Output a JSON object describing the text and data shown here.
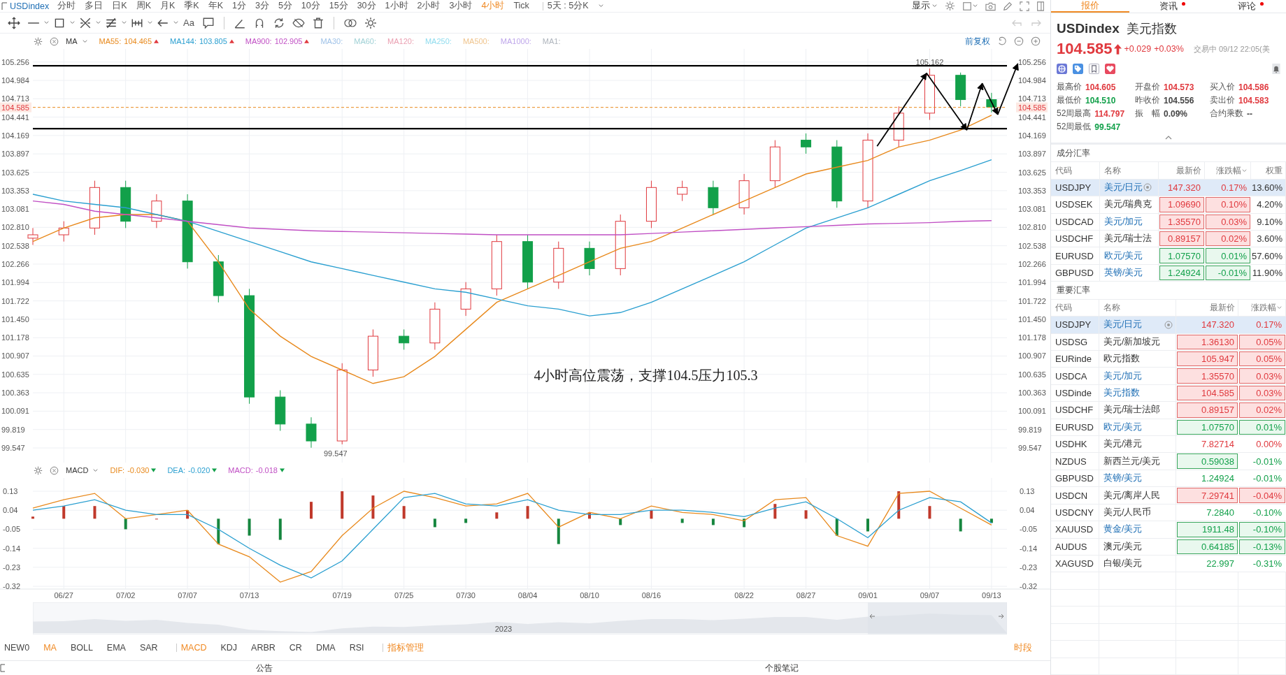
{
  "top_bar": {
    "symbol": "USDindex",
    "periods": [
      {
        "label": "分时",
        "selected": false
      },
      {
        "label": "多日",
        "selected": false
      },
      {
        "label": "日K",
        "selected": false
      },
      {
        "label": "周K",
        "selected": false
      },
      {
        "label": "月K",
        "selected": false
      },
      {
        "label": "季K",
        "selected": false
      },
      {
        "label": "年K",
        "selected": false
      },
      {
        "label": "1分",
        "selected": false
      },
      {
        "label": "3分",
        "selected": false
      },
      {
        "label": "5分",
        "selected": false
      },
      {
        "label": "10分",
        "selected": false
      },
      {
        "label": "15分",
        "selected": false
      },
      {
        "label": "30分",
        "selected": false
      },
      {
        "label": "1小时",
        "selected": false
      },
      {
        "label": "2小时",
        "selected": false
      },
      {
        "label": "3小时",
        "selected": false
      },
      {
        "label": "4小时",
        "selected": true
      },
      {
        "label": "Tick",
        "selected": false
      }
    ],
    "range_select": "5天 : 5分K",
    "display_menu": "显示"
  },
  "toolbar": {
    "text_tool": "Aa"
  },
  "indicator_legend": {
    "name": "MA",
    "adjust_label": "前复权",
    "items": [
      {
        "label": "MA55:",
        "value": "104.465",
        "color": "#e8891c",
        "rising": true
      },
      {
        "label": "MA144:",
        "value": "103.805",
        "color": "#2a9fd0",
        "rising": true
      },
      {
        "label": "MA900:",
        "value": "102.905",
        "color": "#c04fc4",
        "rising": true
      },
      {
        "label": "MA30:",
        "color": "#9fc2e8"
      },
      {
        "label": "MA60:",
        "color": "#9fd0d5"
      },
      {
        "label": "MA120:",
        "color": "#ea9fb1"
      },
      {
        "label": "MA250:",
        "color": "#8fdcee"
      },
      {
        "label": "MA500:",
        "color": "#efc48d"
      },
      {
        "label": "MA1000:",
        "color": "#bea6ea"
      },
      {
        "label": "MA1:",
        "color": "#aeb4bc"
      }
    ]
  },
  "chart": {
    "right_axis": [
      "105.256",
      "104.984",
      "104.713",
      "104.441",
      "104.169",
      "103.897",
      "103.625",
      "103.353",
      "103.081",
      "102.810",
      "102.538",
      "102.266",
      "101.994",
      "101.722",
      "101.450",
      "101.178",
      "100.907",
      "100.635",
      "100.363",
      "100.091",
      "99.819",
      "99.547"
    ],
    "right_price_tag": "104.585",
    "chart_data": {
      "type": "candlestick",
      "grid": true,
      "ylim": [
        99.33,
        105.45
      ],
      "categories": [
        null,
        null,
        null,
        null,
        null,
        null,
        null,
        null,
        null,
        null,
        null,
        null,
        null,
        null,
        null,
        null,
        null,
        null,
        null,
        null,
        null,
        null,
        null,
        null,
        null,
        null,
        null,
        null,
        null,
        null,
        null,
        null
      ],
      "yticks": [
        105.256,
        104.984,
        104.713,
        104.441,
        104.169,
        103.897,
        103.625,
        103.353,
        103.081,
        {
          "value": 102.81,
          "label": "102.810"
        },
        102.538,
        102.266,
        101.994,
        101.722,
        {
          "value": 101.45,
          "label": "101.450"
        },
        101.178,
        100.907,
        100.635,
        100.363,
        100.091,
        99.819,
        99.547
      ],
      "ohlc": [
        [
          102.65,
          102.8,
          102.55,
          102.7
        ],
        [
          102.7,
          102.9,
          102.6,
          102.8
        ],
        [
          102.8,
          103.5,
          102.7,
          103.4
        ],
        [
          103.4,
          103.5,
          102.8,
          102.9
        ],
        [
          102.9,
          103.3,
          102.8,
          103.2
        ],
        [
          103.2,
          103.3,
          102.2,
          102.3
        ],
        [
          102.3,
          102.4,
          101.7,
          101.8
        ],
        [
          101.8,
          101.9,
          100.2,
          100.3
        ],
        [
          100.3,
          100.4,
          99.8,
          99.9
        ],
        [
          99.9,
          100.0,
          99.55,
          99.65
        ],
        [
          99.65,
          100.8,
          99.6,
          100.7
        ],
        [
          100.7,
          101.3,
          100.6,
          101.2
        ],
        [
          101.2,
          101.3,
          101.0,
          101.1
        ],
        [
          101.1,
          101.7,
          101.0,
          101.6
        ],
        [
          101.6,
          102.0,
          101.5,
          101.9
        ],
        [
          101.9,
          102.7,
          101.8,
          102.6
        ],
        [
          102.6,
          102.7,
          101.9,
          102.0
        ],
        [
          102.0,
          102.6,
          101.9,
          102.5
        ],
        [
          102.5,
          102.6,
          102.1,
          102.2
        ],
        [
          102.2,
          103.0,
          102.1,
          102.9
        ],
        [
          102.9,
          103.5,
          102.8,
          103.4
        ],
        [
          103.3,
          103.5,
          103.2,
          103.4
        ],
        [
          103.4,
          103.5,
          103.0,
          103.1
        ],
        [
          103.1,
          103.6,
          103.0,
          103.5
        ],
        [
          103.5,
          104.1,
          103.4,
          104.0
        ],
        [
          104.1,
          104.2,
          103.9,
          104.0
        ],
        [
          104.0,
          104.1,
          103.1,
          103.2
        ],
        [
          103.2,
          104.2,
          103.1,
          104.1
        ],
        [
          104.1,
          104.6,
          104.0,
          104.5
        ],
        [
          104.5,
          105.16,
          104.4,
          105.06
        ],
        [
          105.06,
          105.1,
          104.6,
          104.7
        ],
        [
          104.7,
          104.8,
          104.51,
          104.59
        ]
      ],
      "series": [
        {
          "type": "line",
          "color": "#e8891c",
          "values": [
            102.6,
            102.8,
            102.95,
            103.0,
            103.0,
            102.9,
            102.3,
            101.6,
            101.2,
            100.9,
            100.7,
            100.5,
            100.6,
            100.9,
            101.3,
            101.7,
            101.9,
            102.1,
            102.3,
            102.5,
            102.6,
            102.8,
            103.0,
            103.2,
            103.4,
            103.6,
            103.7,
            103.8,
            104.0,
            104.1,
            104.25,
            104.47
          ]
        },
        {
          "type": "line",
          "color": "#2a9fd0",
          "values": [
            103.3,
            103.2,
            103.15,
            103.1,
            103.0,
            102.9,
            102.75,
            102.6,
            102.45,
            102.3,
            102.2,
            102.1,
            102.0,
            101.9,
            101.85,
            101.75,
            101.65,
            101.6,
            101.5,
            101.55,
            101.7,
            101.9,
            102.1,
            102.3,
            102.55,
            102.8,
            102.95,
            103.1,
            103.3,
            103.5,
            103.65,
            103.81
          ]
        },
        {
          "type": "line",
          "color": "#c04fc4",
          "values": [
            103.2,
            103.15,
            103.05,
            103.0,
            102.95,
            102.9,
            102.85,
            102.8,
            102.78,
            102.76,
            102.75,
            102.74,
            102.73,
            102.72,
            102.71,
            102.7,
            102.7,
            102.7,
            102.7,
            102.7,
            102.72,
            102.74,
            102.76,
            102.78,
            102.8,
            102.82,
            102.84,
            102.86,
            102.87,
            102.88,
            102.9,
            102.91
          ]
        }
      ],
      "ref_lines": [
        {
          "axis": "y",
          "value": 105.2
        },
        {
          "axis": "y",
          "value": 104.27
        },
        {
          "axis": "y",
          "value": 104.585,
          "label": "104.585"
        }
      ],
      "annotations": [
        "105.162",
        "99.547",
        "4小时高位震荡，支撑104.5压力105.3"
      ]
    }
  },
  "macd_legend": {
    "name": "MACD",
    "items": [
      {
        "label": "DIF:",
        "value": "-0.030",
        "color": "#e8891c",
        "rising": false
      },
      {
        "label": "DEA:",
        "value": "-0.020",
        "color": "#2a9fd0",
        "rising": false
      },
      {
        "label": "MACD:",
        "value": "-0.018",
        "color": "#c04fc4",
        "rising": false
      }
    ]
  },
  "macd": {
    "right_axis": [
      "0.13",
      "0.04",
      "-0.05",
      "-0.14",
      "-0.23",
      "-0.32"
    ],
    "chart_data": {
      "type": "line",
      "grid": true,
      "ylim": [
        -0.333,
        0.193
      ],
      "yticks": [
        0.13,
        0.04,
        -0.05,
        -0.14,
        -0.23,
        -0.32
      ],
      "categories": [
        null,
        "06/27",
        null,
        "07/02",
        null,
        "07/07",
        null,
        "07/13",
        null,
        null,
        "07/19",
        null,
        "07/25",
        null,
        "07/30",
        null,
        "08/04",
        null,
        "08/10",
        null,
        "08/16",
        null,
        null,
        "08/22",
        null,
        "08/27",
        null,
        "09/01",
        null,
        "09/07",
        null,
        "09/13"
      ],
      "series": [
        {
          "type": "bar",
          "color": "#c0392b",
          "values": [
            0.01,
            0.06,
            0.06,
            null,
            0.0,
            0.04,
            null,
            null,
            null,
            0.08,
            0.13,
            0.11,
            0.06,
            null,
            null,
            0.03,
            0.06,
            null,
            0.03,
            null,
            0.04,
            null,
            null,
            null,
            0.07,
            0.04,
            null,
            null,
            0.13,
            0.06,
            null,
            null
          ]
        },
        {
          "type": "bar",
          "color": "#16863f",
          "values": [
            null,
            null,
            null,
            -0.05,
            null,
            null,
            -0.12,
            -0.08,
            -0.1,
            null,
            null,
            null,
            null,
            -0.04,
            -0.02,
            null,
            null,
            -0.12,
            null,
            -0.03,
            null,
            -0.02,
            -0.03,
            -0.04,
            null,
            null,
            -0.08,
            -0.06,
            null,
            null,
            -0.06,
            -0.02
          ]
        },
        {
          "color": "#e8891c",
          "values": [
            0.05,
            0.09,
            0.12,
            0.0,
            0.02,
            0.04,
            -0.12,
            -0.18,
            -0.3,
            -0.25,
            -0.08,
            0.05,
            0.13,
            0.1,
            0.06,
            0.07,
            0.12,
            -0.04,
            0.03,
            0.0,
            0.06,
            0.03,
            0.02,
            -0.01,
            0.09,
            0.1,
            -0.08,
            -0.13,
            0.12,
            0.13,
            0.05,
            -0.03
          ]
        },
        {
          "color": "#2a9fd0",
          "values": [
            0.04,
            0.06,
            0.09,
            0.04,
            0.02,
            0.02,
            -0.05,
            -0.14,
            -0.22,
            -0.28,
            -0.2,
            -0.05,
            0.1,
            0.12,
            0.07,
            0.06,
            0.09,
            0.04,
            0.02,
            0.02,
            0.04,
            0.04,
            0.03,
            0.01,
            0.05,
            0.08,
            0.0,
            -0.09,
            0.04,
            0.1,
            0.08,
            -0.02
          ]
        }
      ]
    }
  },
  "navigator": {
    "year": "2023"
  },
  "indicator_tabs": [
    {
      "label": "NEW0",
      "kind": "main",
      "selected": false
    },
    {
      "label": "MA",
      "kind": "main",
      "selected": true
    },
    {
      "label": "BOLL",
      "kind": "main",
      "selected": false
    },
    {
      "label": "EMA",
      "kind": "main",
      "selected": false
    },
    {
      "label": "SAR",
      "kind": "main",
      "selected": false
    },
    {
      "label": "MACD",
      "kind": "sub",
      "selected": true
    },
    {
      "label": "KDJ",
      "kind": "sub",
      "selected": false
    },
    {
      "label": "ARBR",
      "kind": "sub",
      "selected": false
    },
    {
      "label": "CR",
      "kind": "sub",
      "selected": false
    },
    {
      "label": "DMA",
      "kind": "sub",
      "selected": false
    },
    {
      "label": "RSI",
      "kind": "sub",
      "selected": false
    },
    {
      "label": "指标管理",
      "kind": "manage"
    }
  ],
  "time_segment": "时段",
  "bottom_tabs": [
    "公告",
    "个股笔记"
  ],
  "quote_panel": {
    "tabs": [
      {
        "label": "报价",
        "selected": true,
        "dot": false
      },
      {
        "label": "资讯",
        "selected": false,
        "dot": true
      },
      {
        "label": "评论",
        "selected": false,
        "dot": true
      }
    ],
    "code": "USDindex",
    "name": "美元指数",
    "price": "104.585",
    "rising": true,
    "change": "+0.029",
    "change_pct": "+0.03%",
    "status": "交易中 09/12 22:05(美",
    "stats": [
      {
        "label": "最高价",
        "value": "104.605",
        "color": "#e0393e"
      },
      {
        "label": "开盘价",
        "value": "104.573",
        "color": "#e0393e"
      },
      {
        "label": "买入价",
        "value": "104.586",
        "color": "#e0393e"
      },
      {
        "label": "最低价",
        "value": "104.510",
        "color": "#12a04a"
      },
      {
        "label": "昨收价",
        "value": "104.556",
        "color": "#444444"
      },
      {
        "label": "卖出价",
        "value": "104.583",
        "color": "#e0393e"
      },
      {
        "label": "52周最高",
        "value": "114.797",
        "color": "#e0393e"
      },
      {
        "label": "振　幅",
        "value": "0.09%",
        "color": "#444444"
      },
      {
        "label": "合约乘数",
        "value": "--",
        "color": "#444444"
      },
      {
        "label": "52周最低",
        "value": "99.547",
        "color": "#12a04a"
      }
    ],
    "components": {
      "title": "成分汇率",
      "columns": [
        {
          "label": "代码",
          "sortable": false
        },
        {
          "label": "名称",
          "sortable": false
        },
        {
          "label": "最新价",
          "sortable": false
        },
        {
          "label": "涨跌幅",
          "sortable": true
        },
        {
          "label": "权重",
          "sortable": false
        }
      ],
      "rows": [
        {
          "code": "USDJPY",
          "name": "美元/日元",
          "linked": true,
          "pinned": true,
          "price": "147.320",
          "change": "0.17%",
          "weight": "13.60%",
          "rising": true,
          "price_boxed": false,
          "change_boxed": false,
          "selected": true
        },
        {
          "code": "USDSEK",
          "name": "美元/瑞典克",
          "linked": false,
          "pinned": false,
          "price": "1.09690",
          "change": "0.10%",
          "weight": "4.20%",
          "rising": true,
          "price_boxed": true,
          "change_boxed": true,
          "selected": false
        },
        {
          "code": "USDCAD",
          "name": "美元/加元",
          "linked": true,
          "pinned": false,
          "price": "1.35570",
          "change": "0.03%",
          "weight": "9.10%",
          "rising": true,
          "price_boxed": true,
          "change_boxed": true,
          "selected": false
        },
        {
          "code": "USDCHF",
          "name": "美元/瑞士法",
          "linked": false,
          "pinned": false,
          "price": "0.89157",
          "change": "0.02%",
          "weight": "3.60%",
          "rising": true,
          "price_boxed": true,
          "change_boxed": true,
          "selected": false
        },
        {
          "code": "EURUSD",
          "name": "欧元/美元",
          "linked": true,
          "pinned": false,
          "price": "1.07570",
          "change": "0.01%",
          "weight": "57.60%",
          "rising": false,
          "price_boxed": true,
          "change_boxed": true,
          "selected": false
        },
        {
          "code": "GBPUSD",
          "name": "英镑/美元",
          "linked": true,
          "pinned": false,
          "price": "1.24924",
          "change": "-0.01%",
          "weight": "11.90%",
          "rising": false,
          "price_boxed": true,
          "change_boxed": true,
          "selected": false
        }
      ]
    },
    "majors": {
      "title": "重要汇率",
      "columns": [
        {
          "label": "代码",
          "sortable": false
        },
        {
          "label": "名称",
          "sortable": false
        },
        {
          "label": "最新价",
          "sortable": false
        },
        {
          "label": "涨跌幅",
          "sortable": true
        }
      ],
      "rows": [
        {
          "code": "USDJPY",
          "name": "美元/日元",
          "linked": true,
          "pinned": true,
          "price": "147.320",
          "change": "0.17%",
          "rising": true,
          "price_boxed": false,
          "change_boxed": false,
          "selected": true
        },
        {
          "code": "USDSG",
          "name": "美元/新加坡元",
          "linked": false,
          "pinned": false,
          "price": "1.36130",
          "change": "0.05%",
          "rising": true,
          "price_boxed": true,
          "change_boxed": true,
          "selected": false
        },
        {
          "code": "EURinde",
          "name": "欧元指数",
          "linked": false,
          "pinned": false,
          "price": "105.947",
          "change": "0.05%",
          "rising": true,
          "price_boxed": true,
          "change_boxed": true,
          "selected": false
        },
        {
          "code": "USDCA",
          "name": "美元/加元",
          "linked": true,
          "pinned": false,
          "price": "1.35570",
          "change": "0.03%",
          "rising": true,
          "price_boxed": true,
          "change_boxed": true,
          "selected": false
        },
        {
          "code": "USDinde",
          "name": "美元指数",
          "linked": true,
          "pinned": false,
          "price": "104.585",
          "change": "0.03%",
          "rising": true,
          "price_boxed": true,
          "change_boxed": true,
          "selected": false
        },
        {
          "code": "USDCHF",
          "name": "美元/瑞士法郎",
          "linked": false,
          "pinned": false,
          "price": "0.89157",
          "change": "0.02%",
          "rising": true,
          "price_boxed": true,
          "change_boxed": true,
          "selected": false
        },
        {
          "code": "EURUSD",
          "name": "欧元/美元",
          "linked": true,
          "pinned": false,
          "price": "1.07570",
          "change": "0.01%",
          "rising": false,
          "price_boxed": true,
          "change_boxed": true,
          "selected": false
        },
        {
          "code": "USDHK",
          "name": "美元/港元",
          "linked": false,
          "pinned": false,
          "price": "7.82714",
          "change": "0.00%",
          "rising": true,
          "price_boxed": false,
          "change_boxed": false,
          "selected": false
        },
        {
          "code": "NZDUS",
          "name": "新西兰元/美元",
          "linked": false,
          "pinned": false,
          "price": "0.59038",
          "change": "-0.01%",
          "rising": false,
          "price_boxed": true,
          "change_boxed": false,
          "selected": false
        },
        {
          "code": "GBPUSD",
          "name": "英镑/美元",
          "linked": true,
          "pinned": false,
          "price": "1.24924",
          "change": "-0.01%",
          "rising": false,
          "price_boxed": false,
          "change_boxed": false,
          "selected": false
        },
        {
          "code": "USDCN",
          "name": "美元/离岸人民",
          "linked": false,
          "pinned": false,
          "price": "7.29741",
          "change": "-0.04%",
          "rising": true,
          "price_boxed": true,
          "change_boxed": true,
          "selected": false
        },
        {
          "code": "USDCNY",
          "name": "美元/人民币",
          "linked": false,
          "pinned": false,
          "price": "7.2840",
          "change": "-0.10%",
          "rising": false,
          "price_boxed": false,
          "change_boxed": false,
          "selected": false
        },
        {
          "code": "XAUUSD",
          "name": "黄金/美元",
          "linked": true,
          "pinned": false,
          "price": "1911.48",
          "change": "-0.10%",
          "rising": false,
          "price_boxed": true,
          "change_boxed": true,
          "selected": false
        },
        {
          "code": "AUDUS",
          "name": "澳元/美元",
          "linked": false,
          "pinned": false,
          "price": "0.64185",
          "change": "-0.13%",
          "rising": false,
          "price_boxed": true,
          "change_boxed": true,
          "selected": false
        },
        {
          "code": "XAGUSD",
          "name": "白银/美元",
          "linked": false,
          "pinned": false,
          "price": "22.997",
          "change": "-0.31%",
          "rising": false,
          "price_boxed": false,
          "change_boxed": false,
          "selected": false
        }
      ]
    }
  }
}
